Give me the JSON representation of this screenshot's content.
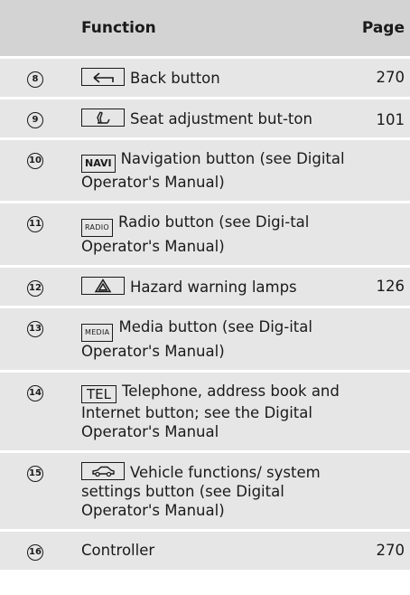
{
  "header": {
    "number": "",
    "function": "Function",
    "page": "Page"
  },
  "rows": [
    {
      "num": "8",
      "key": "",
      "key_icon": "back-arrow-icon",
      "text": "Back button",
      "page": "270"
    },
    {
      "num": "9",
      "key": "",
      "key_icon": "seat-icon",
      "text": "Seat adjustment but-ton",
      "page": "101"
    },
    {
      "num": "10",
      "key": "NAVI",
      "text": "Navigation button (see Digital Operator's Manual)",
      "page": ""
    },
    {
      "num": "11",
      "key": "RADIO",
      "text": "Radio button (see Digi-tal Operator's Manual)",
      "page": ""
    },
    {
      "num": "12",
      "key": "",
      "key_icon": "hazard-triangle-icon",
      "text": "Hazard warning lamps",
      "page": "126"
    },
    {
      "num": "13",
      "key": "MEDIA",
      "text": "Media button (see Dig-ital Operator's Manual)",
      "page": ""
    },
    {
      "num": "14",
      "key": "TEL",
      "text": "Telephone, address book and Internet button; see the Digital Operator's Manual",
      "page": ""
    },
    {
      "num": "15",
      "key": "",
      "key_icon": "car-icon",
      "text": "Vehicle functions/ system settings button (see Digital Operator's Manual)",
      "page": ""
    },
    {
      "num": "16",
      "key": "",
      "text": "Controller",
      "page": "270"
    }
  ]
}
